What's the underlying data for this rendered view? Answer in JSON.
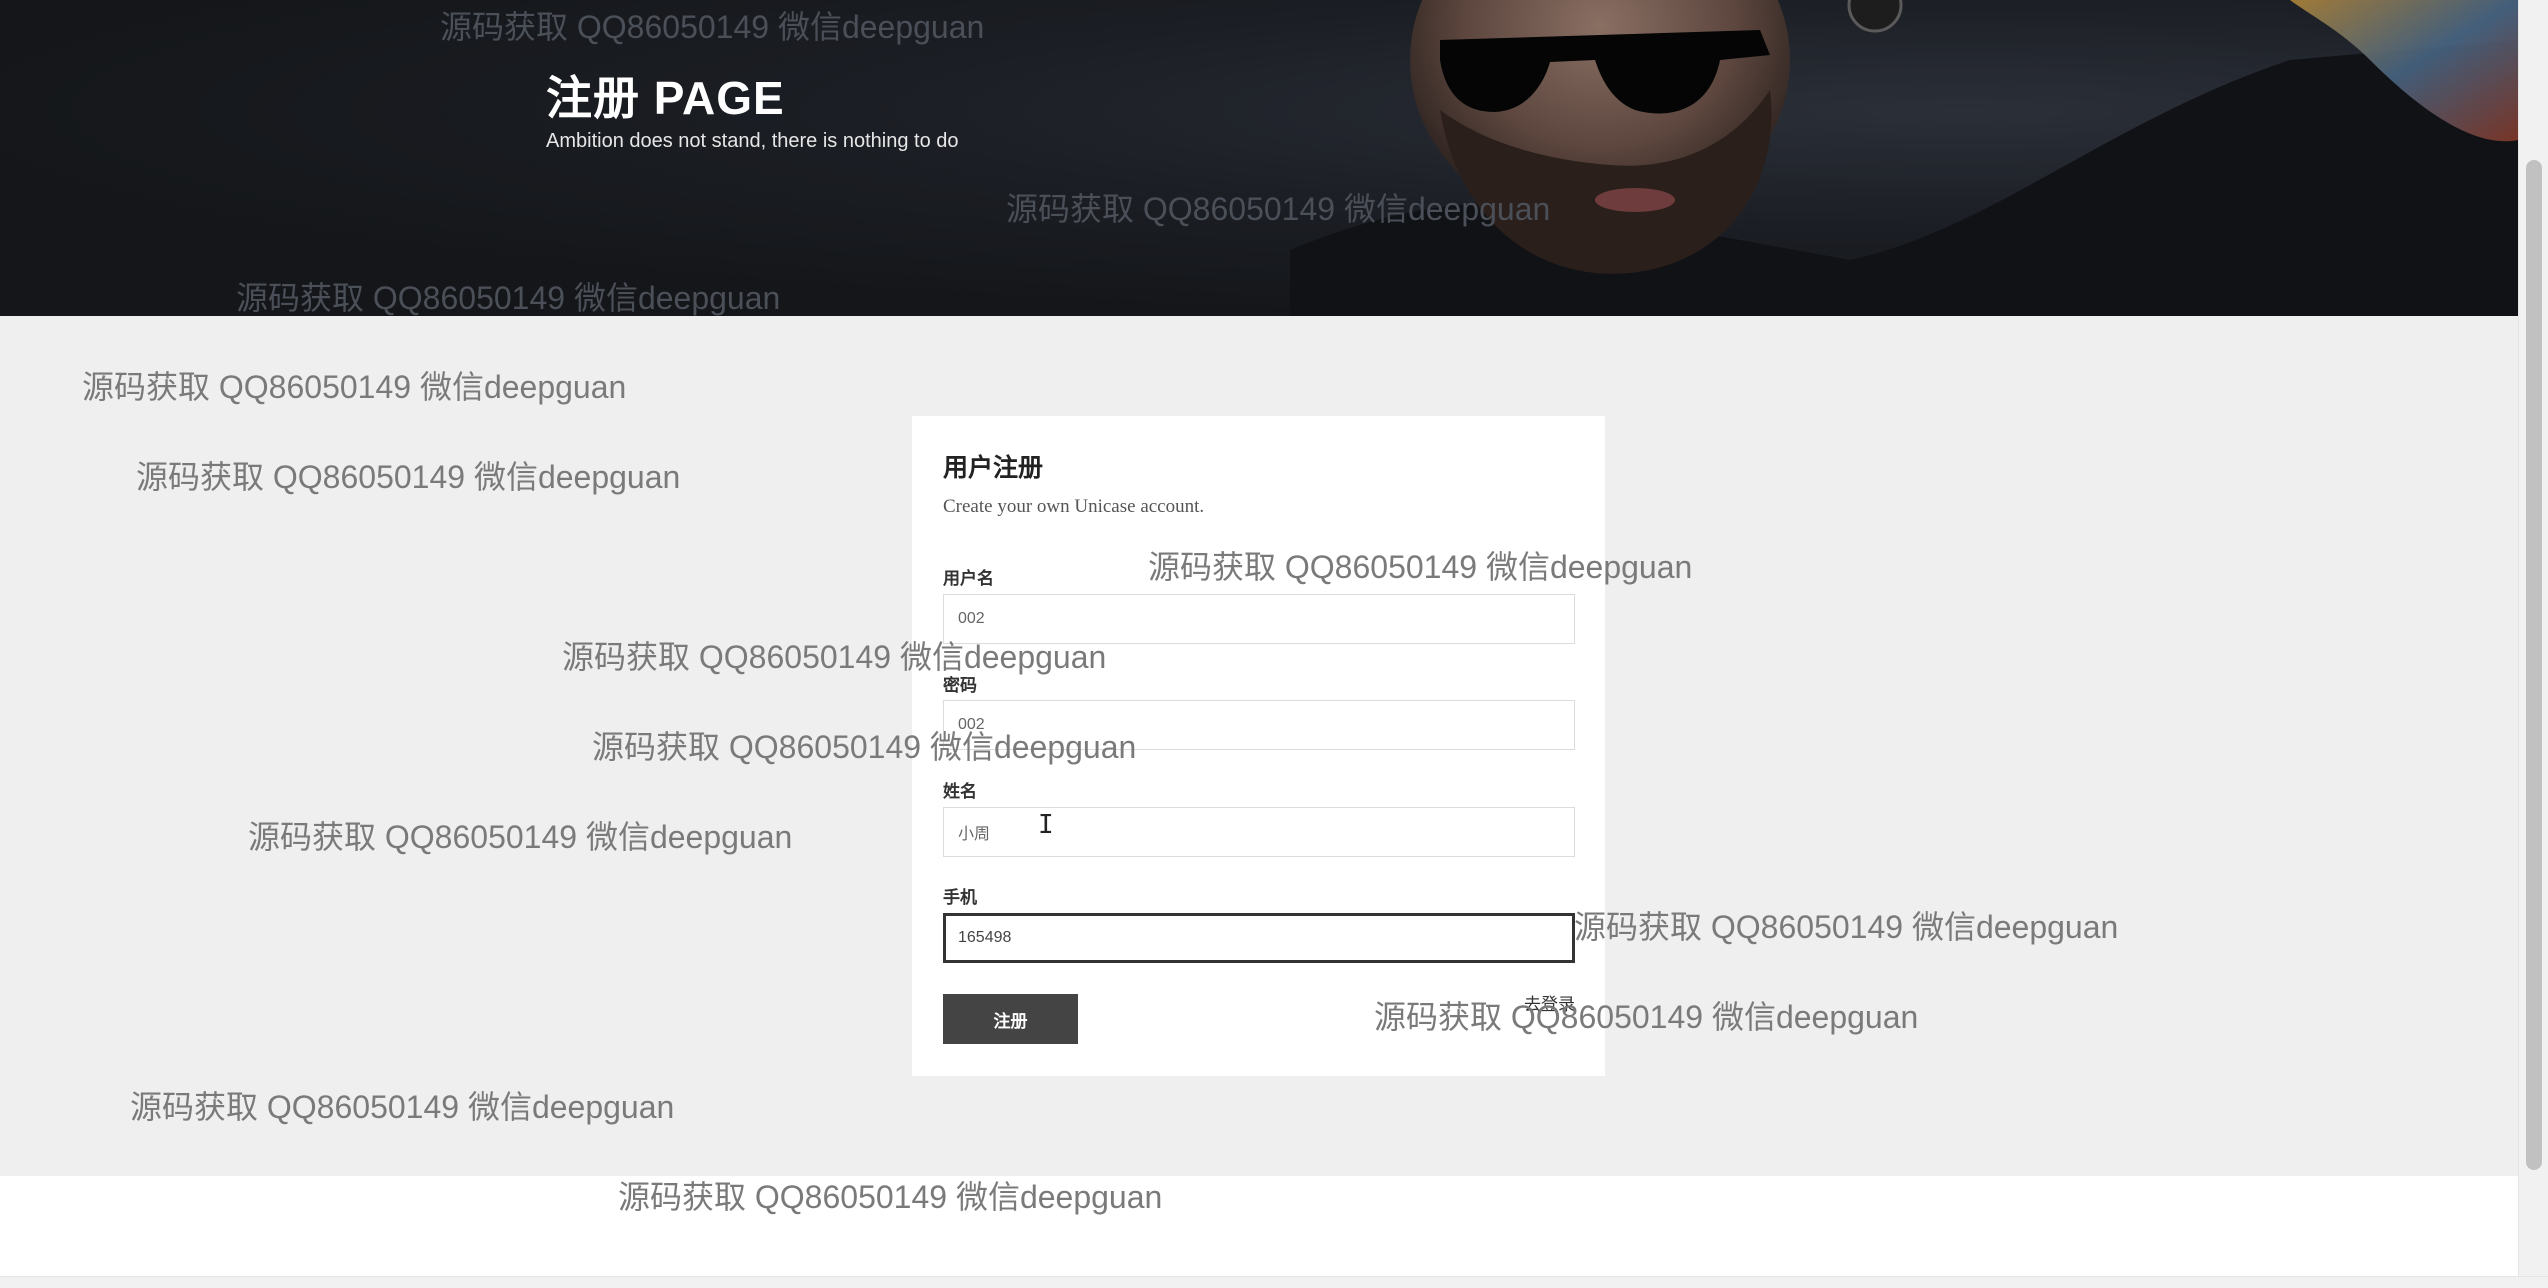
{
  "hero": {
    "title": "注册 PAGE",
    "subtitle": "Ambition does not stand, there is nothing to do"
  },
  "form": {
    "title": "用户注册",
    "description": "Create your own Unicase account.",
    "fields": [
      {
        "label": "用户名",
        "value": "002"
      },
      {
        "label": "密码",
        "value": "002"
      },
      {
        "label": "姓名",
        "value": "小周"
      },
      {
        "label": "手机",
        "value": "165498"
      }
    ],
    "submit_label": "注册",
    "login_link": "去登录"
  },
  "watermark": {
    "text_full": "源码获取 QQ86050149 微信deepguan"
  },
  "colors": {
    "hero_bg": "#16181c",
    "content_bg": "#efefef",
    "button_bg": "#444444",
    "focus_border": "#333333"
  },
  "icons": {
    "cursor": "text-cursor-icon"
  }
}
